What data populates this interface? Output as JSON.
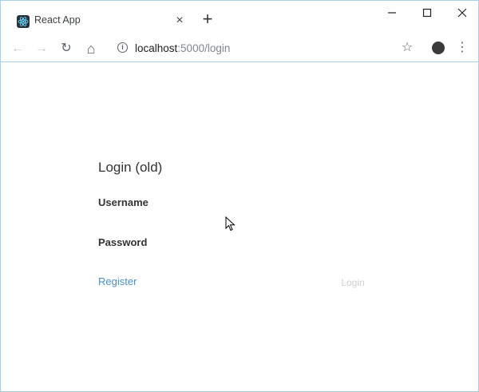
{
  "browser": {
    "tab": {
      "title": "React App",
      "favicon": "react-logo-icon",
      "close_glyph": "×"
    },
    "new_tab_glyph": "+",
    "window_controls": {
      "minimize_glyph": "–",
      "maximize_glyph": "☐",
      "close_glyph": "✕"
    },
    "toolbar": {
      "back_glyph": "←",
      "forward_glyph": "→",
      "reload_glyph": "↻",
      "home_glyph": "⌂",
      "info_glyph": "i",
      "url_host": "localhost",
      "url_rest": ":5000/login",
      "bookmark_glyph": "☆",
      "menu_glyph": "⋮"
    }
  },
  "login_page": {
    "title": "Login (old)",
    "username_label": "Username",
    "password_label": "Password",
    "username_value": "",
    "password_value": "",
    "register_link": "Register",
    "login_button": "Login"
  },
  "colors": {
    "link": "#4a90c8",
    "button_disabled_text": "#cfcfcf",
    "window_border": "#a9cfe3"
  }
}
